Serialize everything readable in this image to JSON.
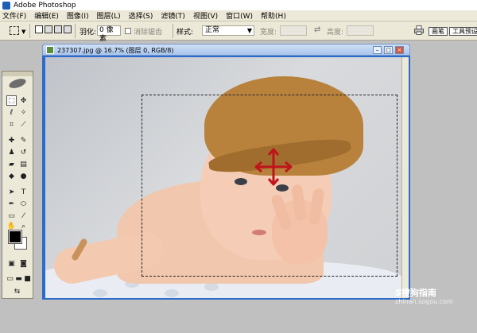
{
  "app": {
    "title": "Adobe Photoshop"
  },
  "menus": [
    "文件(F)",
    "编辑(E)",
    "图像(I)",
    "图层(L)",
    "选择(S)",
    "滤镜(T)",
    "视图(V)",
    "窗口(W)",
    "帮助(H)"
  ],
  "options": {
    "feather_label": "羽化:",
    "feather_value": "0 像素",
    "antialias_label": "消除锯齿",
    "style_label": "样式:",
    "style_value": "正常",
    "width_label": "宽度:",
    "height_label": "高度:"
  },
  "palette_tabs": [
    "画笔",
    "工具预设"
  ],
  "document": {
    "title": "237307.jpg @ 16.7% (图层 0, RGB/8)"
  },
  "watermark": {
    "main": "S搜狗指南",
    "sub": "zhinan.sogou.com"
  },
  "colors": {
    "foreground": "#000000",
    "background": "#ffffff",
    "move_arrow": "#c0141c"
  }
}
